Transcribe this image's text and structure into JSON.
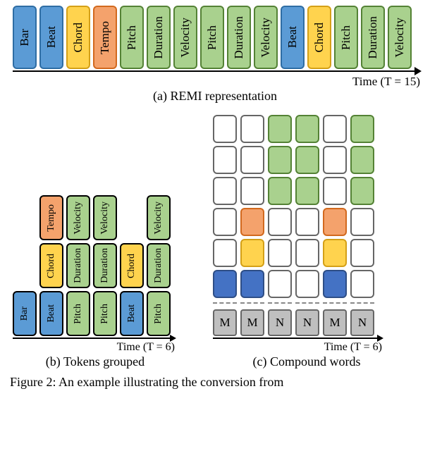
{
  "panelA": {
    "tokens": [
      {
        "label": "Bar",
        "color": "blue"
      },
      {
        "label": "Beat",
        "color": "blue"
      },
      {
        "label": "Chord",
        "color": "yellow"
      },
      {
        "label": "Tempo",
        "color": "orange"
      },
      {
        "label": "Pitch",
        "color": "green"
      },
      {
        "label": "Duration",
        "color": "green"
      },
      {
        "label": "Velocity",
        "color": "green"
      },
      {
        "label": "Pitch",
        "color": "green"
      },
      {
        "label": "Duration",
        "color": "green"
      },
      {
        "label": "Velocity",
        "color": "green"
      },
      {
        "label": "Beat",
        "color": "blue"
      },
      {
        "label": "Chord",
        "color": "yellow"
      },
      {
        "label": "Pitch",
        "color": "green"
      },
      {
        "label": "Duration",
        "color": "green"
      },
      {
        "label": "Velocity",
        "color": "green"
      }
    ],
    "timeLabel": "Time (T = 15)",
    "caption": "(a) REMI representation"
  },
  "panelB": {
    "columns": [
      [
        {
          "label": "Bar",
          "color": "blue"
        }
      ],
      [
        {
          "label": "Tempo",
          "color": "orange"
        },
        {
          "label": "Chord",
          "color": "yellow"
        },
        {
          "label": "Beat",
          "color": "blue"
        }
      ],
      [
        {
          "label": "Velocity",
          "color": "green"
        },
        {
          "label": "Duration",
          "color": "green"
        },
        {
          "label": "Pitch",
          "color": "green"
        }
      ],
      [
        {
          "label": "Velocity",
          "color": "green"
        },
        {
          "label": "Duration",
          "color": "green"
        },
        {
          "label": "Pitch",
          "color": "green"
        }
      ],
      [
        {
          "label": "Chord",
          "color": "yellow"
        },
        {
          "label": "Beat",
          "color": "blue"
        }
      ],
      [
        {
          "label": "Velocity",
          "color": "green"
        },
        {
          "label": "Duration",
          "color": "green"
        },
        {
          "label": "Pitch",
          "color": "green"
        }
      ]
    ],
    "timeLabel": "Time (T = 6)",
    "caption": "(b) Tokens grouped"
  },
  "panelC": {
    "columns": [
      {
        "slots": [
          "white",
          "white",
          "white",
          "white",
          "white",
          "blue"
        ],
        "family": "M"
      },
      {
        "slots": [
          "white",
          "white",
          "white",
          "orange",
          "yellow",
          "blue"
        ],
        "family": "M"
      },
      {
        "slots": [
          "green",
          "green",
          "green",
          "white",
          "white",
          "white"
        ],
        "family": "N"
      },
      {
        "slots": [
          "green",
          "green",
          "green",
          "white",
          "white",
          "white"
        ],
        "family": "N"
      },
      {
        "slots": [
          "white",
          "white",
          "white",
          "orange",
          "yellow",
          "blue"
        ],
        "family": "M"
      },
      {
        "slots": [
          "green",
          "green",
          "green",
          "white",
          "white",
          "white"
        ],
        "family": "N"
      }
    ],
    "timeLabel": "Time (T = 6)",
    "caption": "(c) Compound words"
  },
  "figCaption": "Figure 2:  An example illustrating the conversion from"
}
